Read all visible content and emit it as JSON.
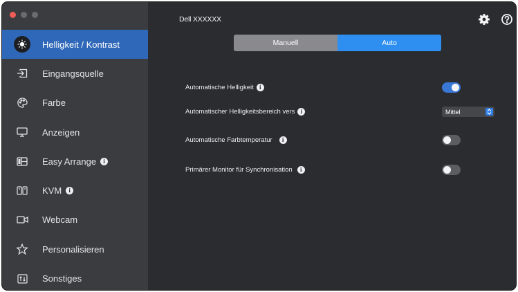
{
  "window": {
    "title": "Dell XXXXXX",
    "traffic_colors": [
      "#ee5c55",
      "#6b6b6f",
      "#6b6b6f"
    ]
  },
  "sidebar": {
    "items": [
      {
        "label": "Helligkeit / Kontrast",
        "icon": "brightness-icon",
        "active": true,
        "info": false
      },
      {
        "label": "Eingangsquelle",
        "icon": "input-source-icon",
        "active": false,
        "info": false
      },
      {
        "label": "Farbe",
        "icon": "color-palette-icon",
        "active": false,
        "info": false
      },
      {
        "label": "Anzeigen",
        "icon": "monitor-icon",
        "active": false,
        "info": false
      },
      {
        "label": "Easy Arrange",
        "icon": "layout-icon",
        "active": false,
        "info": true
      },
      {
        "label": "KVM",
        "icon": "kvm-icon",
        "active": false,
        "info": true
      },
      {
        "label": "Webcam",
        "icon": "webcam-icon",
        "active": false,
        "info": false
      },
      {
        "label": "Personalisieren",
        "icon": "star-icon",
        "active": false,
        "info": false
      },
      {
        "label": "Sonstiges",
        "icon": "others-icon",
        "active": false,
        "info": false
      }
    ]
  },
  "header": {
    "settings_icon": "gear-icon",
    "help_icon": "help-icon"
  },
  "mode": {
    "manual_label": "Manuell",
    "auto_label": "Auto",
    "selected": "Auto"
  },
  "settings": {
    "auto_brightness": {
      "label": "Automatische Helligkeit",
      "enabled": true
    },
    "auto_brightness_range": {
      "label": "Automatischer Helligkeitsbereich vers",
      "value": "Mittel"
    },
    "auto_color_temp": {
      "label": "Automatische Farbtemperatur",
      "enabled": false
    },
    "primary_sync": {
      "label": "Primärer Monitor für Synchronisation",
      "enabled": false
    }
  },
  "colors": {
    "accent": "#2f68b8",
    "toggle_on": "#3a78d8",
    "segment_on": "#2f8ff0"
  }
}
